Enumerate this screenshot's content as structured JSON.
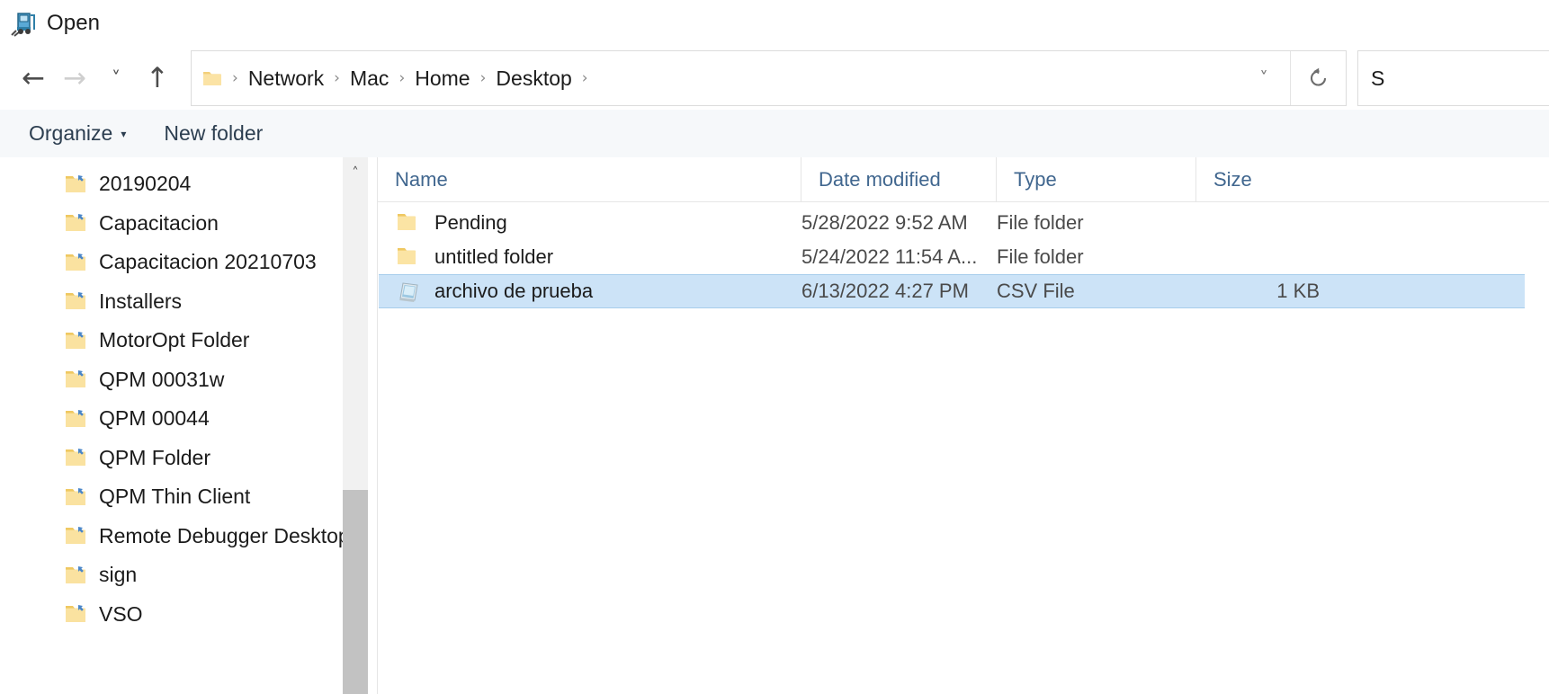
{
  "window": {
    "title": "Open",
    "icon": "forklift-app-icon"
  },
  "nav": {
    "back_icon": "arrow-left-icon",
    "forward_icon": "arrow-right-icon",
    "recent_icon": "chevron-down-icon",
    "up_icon": "arrow-up-icon",
    "dropdown_icon": "chevron-down-icon",
    "refresh_icon": "refresh-icon",
    "folder_icon": "folder-icon",
    "separator": "›",
    "breadcrumbs": [
      "Network",
      "Mac",
      "Home",
      "Desktop"
    ],
    "search_value": "S"
  },
  "toolbar": {
    "organize_label": "Organize",
    "organize_caret": "▾",
    "new_folder_label": "New folder"
  },
  "sidebar": {
    "scroll_up_icon": "chevron-up-icon",
    "items": [
      {
        "label": "20190204",
        "icon": "folder-shortcut-icon"
      },
      {
        "label": "Capacitacion",
        "icon": "folder-shortcut-icon"
      },
      {
        "label": "Capacitacion 20210703",
        "icon": "folder-shortcut-icon"
      },
      {
        "label": "Installers",
        "icon": "folder-shortcut-icon"
      },
      {
        "label": "MotorOpt Folder",
        "icon": "folder-shortcut-icon"
      },
      {
        "label": "QPM 00031w",
        "icon": "folder-shortcut-icon"
      },
      {
        "label": "QPM 00044",
        "icon": "folder-shortcut-icon"
      },
      {
        "label": "QPM Folder",
        "icon": "folder-shortcut-icon"
      },
      {
        "label": "QPM Thin Client",
        "icon": "folder-shortcut-icon"
      },
      {
        "label": "Remote Debugger Desktop",
        "icon": "folder-shortcut-icon"
      },
      {
        "label": "sign",
        "icon": "folder-shortcut-icon"
      },
      {
        "label": "VSO",
        "icon": "folder-shortcut-icon"
      }
    ]
  },
  "filelist": {
    "sort_indicator": "˄",
    "columns": [
      {
        "key": "name",
        "label": "Name"
      },
      {
        "key": "date",
        "label": "Date modified"
      },
      {
        "key": "type",
        "label": "Type"
      },
      {
        "key": "size",
        "label": "Size"
      }
    ],
    "rows": [
      {
        "name": "Pending",
        "date": "5/28/2022 9:52 AM",
        "type": "File folder",
        "size": "",
        "icon": "folder-icon",
        "selected": false
      },
      {
        "name": "untitled folder",
        "date": "5/24/2022 11:54 A...",
        "type": "File folder",
        "size": "",
        "icon": "folder-icon",
        "selected": false
      },
      {
        "name": "archivo de prueba",
        "date": "6/13/2022 4:27 PM",
        "type": "CSV File",
        "size": "1 KB",
        "icon": "csv-file-icon",
        "selected": true
      }
    ]
  },
  "colors": {
    "selection": "#cce3f7",
    "selection_border": "#a7cdec",
    "header_text": "#41678f",
    "toolbar_bg": "#f6f8fa",
    "folder_yellow": "#f8d775"
  }
}
